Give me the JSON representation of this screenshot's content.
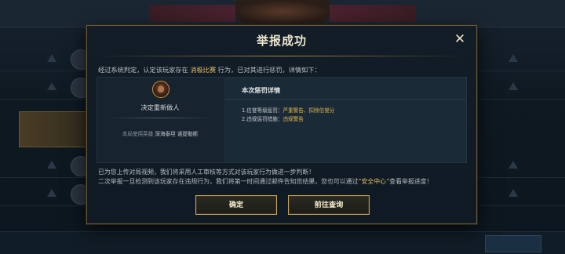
{
  "dialog": {
    "title": "举报成功",
    "close_label": "✕",
    "verdict": {
      "prefix": "经过系统判定，认定该玩家存在",
      "behavior": "消极比赛",
      "suffix": "行为，已对其进行惩罚，详情如下："
    },
    "left": {
      "punish_title": "决定重新做人",
      "hero_prefix": "本局使用英雄",
      "hero_name": "深海泰坦 诺提勒斯"
    },
    "right": {
      "header": "本次惩罚详情",
      "line1_label": "1.信誉等级惩罚：",
      "line1_value": "严重警告、扣除信誉分",
      "line2_label": "2.违规惩罚措施：",
      "line2_value": "违规警告"
    },
    "notice": {
      "line1": "已为您上传对局视频，我们将采用人工审核等方式对该玩家行为做进一步判断！",
      "line2_prefix": "二次举报一旦检测到该玩家存在违规行为，我们将第一时间通过邮件告知您结果，您也可以通过",
      "line2_link": "“安全中心”",
      "line2_suffix": "查看举报进度！"
    },
    "buttons": {
      "ok": "确定",
      "goto": "前往查询"
    }
  },
  "colors": {
    "accent_gold": "#e3c068",
    "border_gold": "#c9a456",
    "panel_bg": "#172430"
  }
}
